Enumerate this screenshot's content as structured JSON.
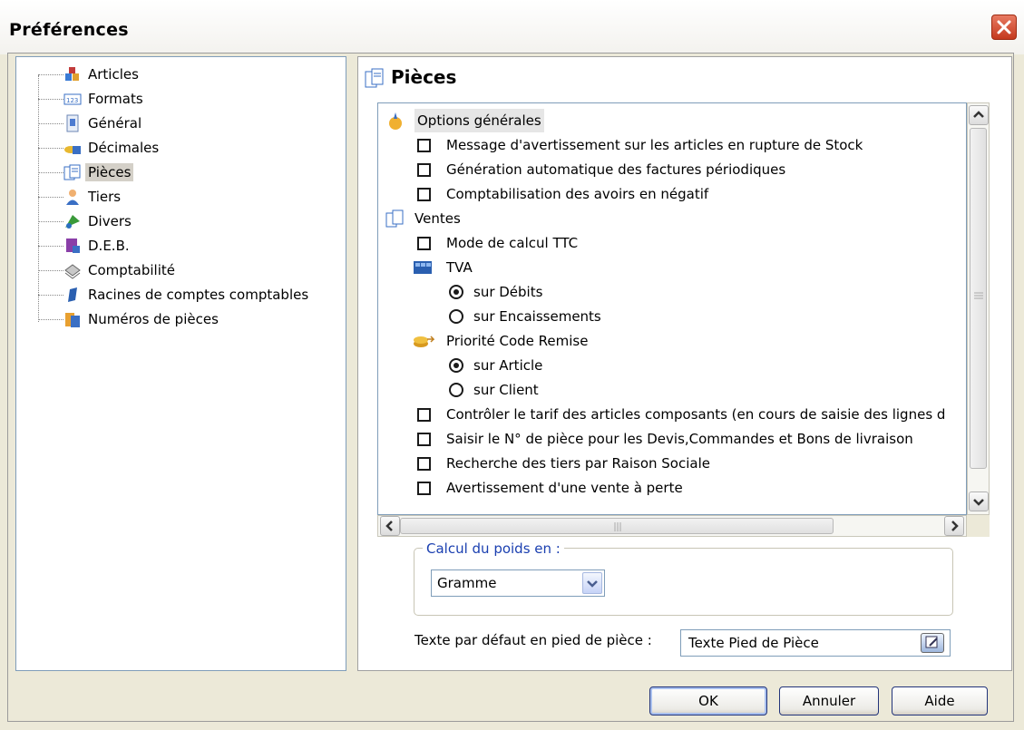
{
  "window": {
    "title": "Préférences"
  },
  "tree": {
    "items": [
      {
        "label": "Articles",
        "icon": "articles-icon"
      },
      {
        "label": "Formats",
        "icon": "formats-icon"
      },
      {
        "label": "Général",
        "icon": "general-icon"
      },
      {
        "label": "Décimales",
        "icon": "decimales-icon"
      },
      {
        "label": "Pièces",
        "icon": "pieces-icon",
        "selected": true
      },
      {
        "label": "Tiers",
        "icon": "tiers-icon"
      },
      {
        "label": "Divers",
        "icon": "divers-icon"
      },
      {
        "label": "D.E.B.",
        "icon": "deb-icon"
      },
      {
        "label": "Comptabilité",
        "icon": "comptabilite-icon"
      },
      {
        "label": "Racines de comptes comptables",
        "icon": "racines-icon"
      },
      {
        "label": "Numéros de pièces",
        "icon": "numeros-icon"
      }
    ]
  },
  "panel": {
    "title": "Pièces",
    "options": {
      "general_header": "Options générales",
      "msg_rupture": "Message d'avertissement sur les articles en rupture de Stock",
      "generation_factures": "Génération automatique des factures périodiques",
      "comptabilisation_avoirs": "Comptabilisation des avoirs en négatif",
      "ventes_header": "Ventes",
      "mode_ttc": "Mode de calcul TTC",
      "tva_header": "TVA",
      "tva_debits": "sur Débits",
      "tva_encaissements": "sur Encaissements",
      "priorite_header": "Priorité Code Remise",
      "priorite_article": "sur Article",
      "priorite_client": "sur Client",
      "controler_tarif": "Contrôler le tarif des articles composants (en cours de saisie des lignes d",
      "saisir_numero": "Saisir le N° de pièce pour les Devis,Commandes et Bons de livraison",
      "recherche_tiers": "Recherche des tiers par Raison Sociale",
      "avertissement_vente": "Avertissement d'une vente à perte"
    },
    "poids": {
      "legend": "Calcul du poids en :",
      "value": "Gramme"
    },
    "pied": {
      "label": "Texte par défaut en pied de pièce :",
      "value": "Texte Pied de Pièce"
    }
  },
  "buttons": {
    "ok": "OK",
    "annuler": "Annuler",
    "aide": "Aide"
  },
  "colors": {
    "accent": "#7f9db9",
    "close": "#c4391e",
    "legend": "#1a3fb0"
  }
}
